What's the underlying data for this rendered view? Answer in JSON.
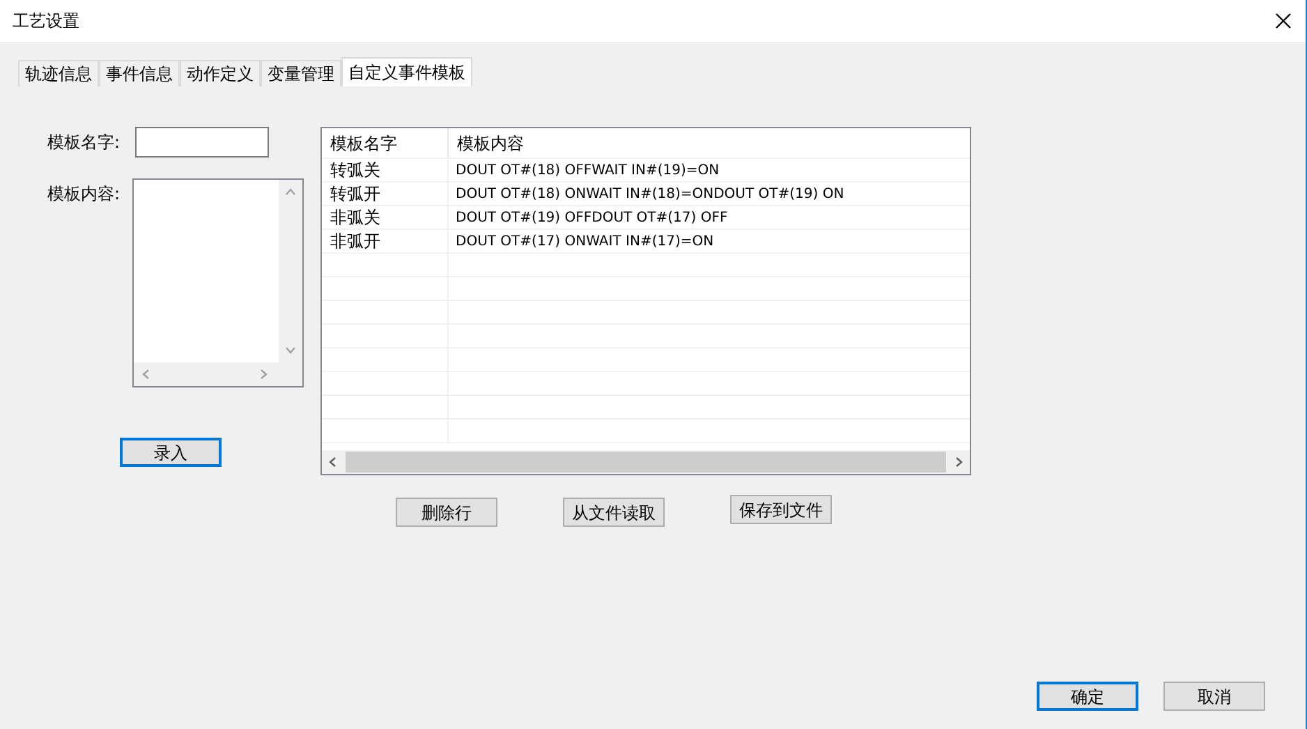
{
  "window": {
    "title": "工艺设置"
  },
  "tabs": [
    {
      "label": "轨迹信息",
      "selected": false
    },
    {
      "label": "事件信息",
      "selected": false
    },
    {
      "label": "动作定义",
      "selected": false
    },
    {
      "label": "变量管理",
      "selected": false
    },
    {
      "label": "自定义事件模板",
      "selected": true
    }
  ],
  "form": {
    "name_label": "模板名字:",
    "content_label": "模板内容:",
    "enter_button": {
      "label": "录入",
      "default": true
    }
  },
  "table": {
    "columns": [
      "模板名字",
      "模板内容"
    ],
    "rows": [
      {
        "name": "转弧关",
        "content": "DOUT OT#(18) OFFWAIT IN#(19)=ON"
      },
      {
        "name": "转弧开",
        "content": "DOUT OT#(18) ONWAIT IN#(18)=ONDOUT OT#(19) ON"
      },
      {
        "name": "非弧关",
        "content": "DOUT OT#(19) OFFDOUT OT#(17) OFF"
      },
      {
        "name": "非弧开",
        "content": "DOUT OT#(17) ONWAIT IN#(17)=ON"
      }
    ]
  },
  "actions": [
    {
      "label": "删除行",
      "default": false
    },
    {
      "label": "从文件读取",
      "default": false
    },
    {
      "label": "保存到文件",
      "default": false
    }
  ],
  "footer_buttons": [
    {
      "label": "确定",
      "default": true
    },
    {
      "label": "取消",
      "default": false
    }
  ]
}
